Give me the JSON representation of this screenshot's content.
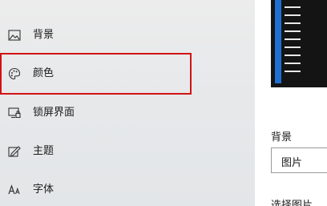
{
  "sidebar": {
    "items": [
      {
        "label": "背景",
        "icon": "picture-icon"
      },
      {
        "label": "颜色",
        "icon": "palette-icon"
      },
      {
        "label": "锁屏界面",
        "icon": "lock-screen-icon"
      },
      {
        "label": "主题",
        "icon": "theme-icon"
      },
      {
        "label": "字体",
        "icon": "font-icon"
      }
    ]
  },
  "main": {
    "background_label": "背景",
    "background_select_value": "图片",
    "choose_picture_label": "选择图片"
  },
  "colors": {
    "highlight": "#d31313",
    "accent": "#1f6fd0"
  }
}
